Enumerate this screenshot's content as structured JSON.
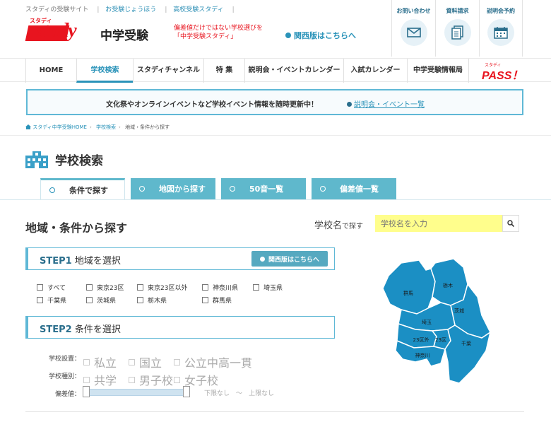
{
  "header": {
    "toplinks": [
      "スタディの受験サイト",
      "お受験じょうほう",
      "高校受験スタディ"
    ],
    "logo_kana": "スタディ",
    "logo_word": "study",
    "logo_jp": "中学受験",
    "tagline": [
      "偏差値だけではない学校選びを",
      "「中学受験スタディ」"
    ],
    "kansai_link": "関西版はこちらへ",
    "icon_buttons": [
      {
        "label": "お問い合わせ",
        "icon": "mail-icon"
      },
      {
        "label": "資料請求",
        "icon": "document-icon"
      },
      {
        "label": "説明会予約",
        "icon": "calendar-icon"
      }
    ]
  },
  "nav": {
    "items": [
      "HOME",
      "学校検索",
      "スタディチャンネル",
      "特 集",
      "説明会・イベントカレンダー",
      "入試カレンダー",
      "中学受験情報局"
    ],
    "active": "学校検索",
    "pass_small": "スタディ",
    "pass_big": "PASS！"
  },
  "notice": {
    "message": "文化祭やオンラインイベントなど学校イベント情報を随時更新中！",
    "link": "説明会・イベント一覧"
  },
  "breadcrumb": [
    "スタディ中学受験HOME",
    "学校検索",
    "地域・条件から探す"
  ],
  "page_title": "学校検索",
  "tabs": [
    "条件で探す",
    "地図から探す",
    "50音一覧",
    "偏差値一覧"
  ],
  "section_title": "地域・条件から探す",
  "search": {
    "label_main": "学校名",
    "label_sub": "で探す",
    "placeholder": "学校名を入力"
  },
  "step1": {
    "step": "STEP1",
    "title": "地域を選択",
    "kansai_button": "関西版はこちらへ",
    "regions": [
      "すべて",
      "東京23区",
      "東京23区以外",
      "神奈川県",
      "埼玉県",
      "千葉県",
      "茨城県",
      "栃木県",
      "群馬県"
    ]
  },
  "step2": {
    "step": "STEP2",
    "title": "条件を選択",
    "rows": [
      {
        "label": "学校設置：",
        "options": [
          "私立",
          "国立",
          "公立中高一貫"
        ]
      },
      {
        "label": "学校種別：",
        "options": [
          "共学",
          "男子校",
          "女子校"
        ]
      }
    ],
    "deviation_label": "偏差値：",
    "range_min": "下限なし",
    "range_sep": "～",
    "range_max": "上限なし"
  },
  "map": {
    "regions": [
      "群馬",
      "栃木",
      "茨城",
      "埼玉",
      "23区外",
      "23区",
      "千葉",
      "神奈川"
    ],
    "fill_color": "#1b8fc4",
    "border_color": "#ffffff"
  }
}
